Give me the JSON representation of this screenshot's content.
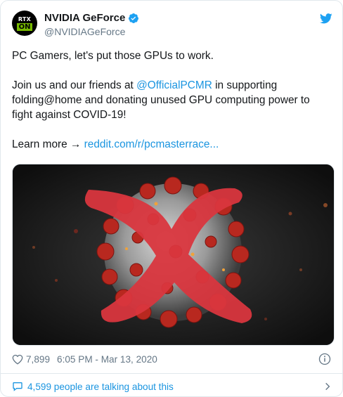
{
  "tweet": {
    "author": {
      "display_name": "NVIDIA GeForce",
      "handle": "@NVIDIAGeForce",
      "avatar_text_top": "RTX",
      "avatar_text_bottom": "ON",
      "verified": true
    },
    "text": {
      "line1": "PC Gamers, let's put those GPUs to work.",
      "p2_before": "Join us and our friends at ",
      "p2_mention": "@OfficialPCMR",
      "p2_after": " in supporting folding@home and donating unused GPU computing power to fight against COVID-19!",
      "p3_prefix": "Learn more → ",
      "p3_link": "reddit.com/r/pcmasterrace..."
    },
    "meta": {
      "likes": "7,899",
      "timestamp": "6:05 PM - Mar 13, 2020"
    },
    "footer": {
      "talking": "4,599 people are talking about this"
    }
  },
  "colors": {
    "link": "#1b95e0",
    "secondary_text": "#657786",
    "brand_green": "#76b900",
    "cross_red": "#d9363e"
  },
  "icons": {
    "verified": "verified-badge-icon",
    "twitter": "twitter-bird-icon",
    "like": "heart-icon",
    "info": "info-icon",
    "reply": "speech-bubble-icon",
    "chevron": "chevron-right-icon"
  }
}
